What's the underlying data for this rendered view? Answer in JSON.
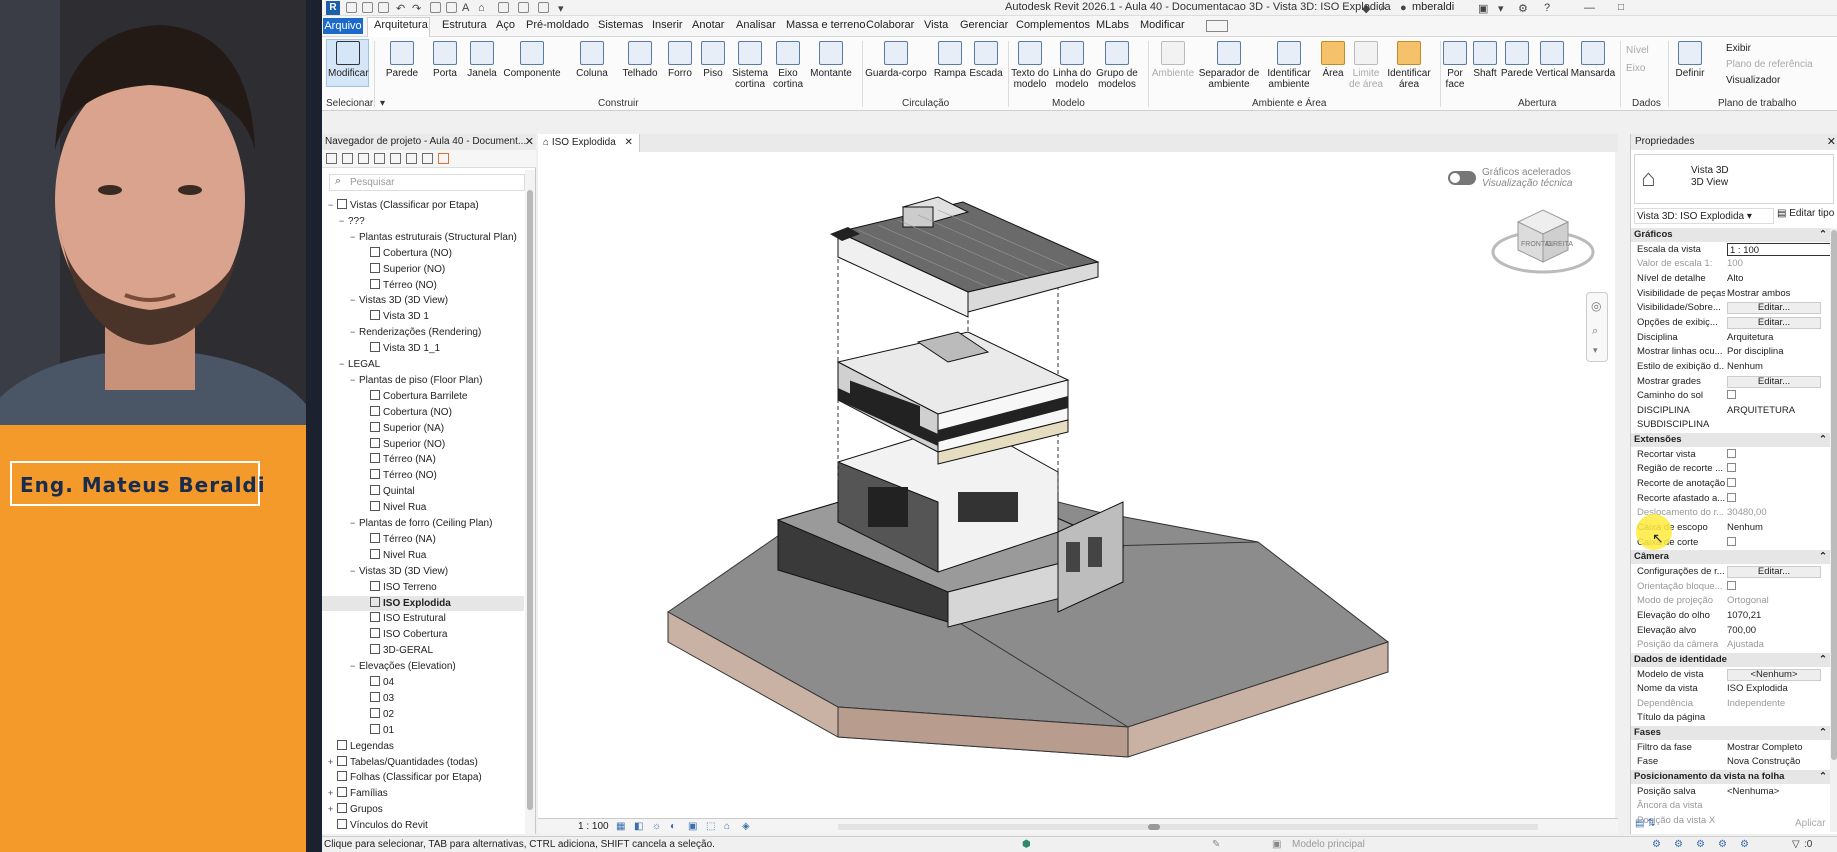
{
  "presenter": {
    "name": "Eng. Mateus Beraldi"
  },
  "app": {
    "title": "Autodesk Revit 2026.1 - Aula 40 - Documentacao 3D - Vista 3D: ISO Explodida",
    "user": "mberaldi",
    "logo_letter": "R"
  },
  "menu": {
    "tabs": [
      "Arquivo",
      "Arquitetura",
      "Estrutura",
      "Aço",
      "Pré-moldado",
      "Sistemas",
      "Inserir",
      "Anotar",
      "Analisar",
      "Massa e terreno",
      "Colaborar",
      "Vista",
      "Gerenciar",
      "Complementos",
      "MLabs",
      "Modificar"
    ]
  },
  "ribbon": {
    "modificar": "Modificar",
    "selecionar": "Selecionar",
    "construir": {
      "label": "Construir",
      "items": [
        "Parede",
        "Porta",
        "Janela",
        "Componente",
        "Coluna",
        "Telhado",
        "Forro",
        "Piso",
        "Sistema cortina",
        "Eixo cortina",
        "Montante"
      ]
    },
    "circulacao": {
      "label": "Circulação",
      "items": [
        "Guarda-corpo",
        "Rampa",
        "Escada"
      ]
    },
    "modelo": {
      "label": "Modelo",
      "items": [
        "Texto do modelo",
        "Linha do modelo",
        "Grupo de modelos"
      ]
    },
    "ambiente": {
      "label": "Ambiente e Área",
      "items": [
        "Ambiente",
        "Separador de ambiente",
        "Identificar ambiente",
        "Área",
        "Limite de área",
        "Identificar área"
      ]
    },
    "abertura": {
      "label": "Abertura",
      "items": [
        "Por face",
        "Shaft",
        "Parede",
        "Vertical",
        "Mansarda"
      ]
    },
    "dados": {
      "label": "Dados",
      "items": [
        "Nível",
        "Eixo"
      ]
    },
    "plano": {
      "label": "Plano de trabalho",
      "items": [
        "Definir",
        "Exibir",
        "Plano de referência",
        "Visualizador"
      ]
    }
  },
  "navigator": {
    "title": "Navegador de projeto - Aula 40 - Document...",
    "search_placeholder": "Pesquisar",
    "tree": [
      {
        "label": "Vistas (Classificar por Etapa)",
        "level": 0,
        "exp": "−",
        "icon": true
      },
      {
        "label": "???",
        "level": 1,
        "exp": "−"
      },
      {
        "label": "Plantas estruturais (Structural Plan)",
        "level": 2,
        "exp": "−"
      },
      {
        "label": "Cobertura (NO)",
        "level": 3,
        "icon": true
      },
      {
        "label": "Superior (NO)",
        "level": 3,
        "icon": true
      },
      {
        "label": "Térreo (NO)",
        "level": 3,
        "icon": true
      },
      {
        "label": "Vistas 3D (3D View)",
        "level": 2,
        "exp": "−"
      },
      {
        "label": "Vista 3D 1",
        "level": 3,
        "icon": true
      },
      {
        "label": "Renderizações (Rendering)",
        "level": 2,
        "exp": "−"
      },
      {
        "label": "Vista 3D 1_1",
        "level": 3,
        "icon": true
      },
      {
        "label": "LEGAL",
        "level": 1,
        "exp": "−"
      },
      {
        "label": "Plantas de piso (Floor Plan)",
        "level": 2,
        "exp": "−"
      },
      {
        "label": "Cobertura Barrilete",
        "level": 3,
        "icon": true
      },
      {
        "label": "Cobertura (NO)",
        "level": 3,
        "icon": true
      },
      {
        "label": "Superior (NA)",
        "level": 3,
        "icon": true
      },
      {
        "label": "Superior (NO)",
        "level": 3,
        "icon": true
      },
      {
        "label": "Térreo (NA)",
        "level": 3,
        "icon": true
      },
      {
        "label": "Térreo (NO)",
        "level": 3,
        "icon": true
      },
      {
        "label": "Quintal",
        "level": 3,
        "icon": true
      },
      {
        "label": "Nivel Rua",
        "level": 3,
        "icon": true
      },
      {
        "label": "Plantas de forro (Ceiling Plan)",
        "level": 2,
        "exp": "−"
      },
      {
        "label": "Térreo (NA)",
        "level": 3,
        "icon": true
      },
      {
        "label": "Nivel Rua",
        "level": 3,
        "icon": true
      },
      {
        "label": "Vistas 3D (3D View)",
        "level": 2,
        "exp": "−"
      },
      {
        "label": "ISO Terreno",
        "level": 3,
        "icon": true
      },
      {
        "label": "ISO Explodida",
        "level": 3,
        "icon": true,
        "selected": true
      },
      {
        "label": "ISO Estrutural",
        "level": 3,
        "icon": true
      },
      {
        "label": "ISO Cobertura",
        "level": 3,
        "icon": true
      },
      {
        "label": "3D-GERAL",
        "level": 3,
        "icon": true
      },
      {
        "label": "Elevações (Elevation)",
        "level": 2,
        "exp": "−"
      },
      {
        "label": "04",
        "level": 3,
        "icon": true
      },
      {
        "label": "03",
        "level": 3,
        "icon": true
      },
      {
        "label": "02",
        "level": 3,
        "icon": true
      },
      {
        "label": "01",
        "level": 3,
        "icon": true
      },
      {
        "label": "Legendas",
        "level": 0,
        "icon": true
      },
      {
        "label": "Tabelas/Quantidades (todas)",
        "level": 0,
        "exp": "+",
        "icon": true
      },
      {
        "label": "Folhas (Classificar por Etapa)",
        "level": 0,
        "icon": true
      },
      {
        "label": "Famílias",
        "level": 0,
        "exp": "+",
        "icon": true
      },
      {
        "label": "Grupos",
        "level": 0,
        "exp": "+",
        "icon": true
      },
      {
        "label": "Vínculos do Revit",
        "level": 0,
        "icon": true
      }
    ]
  },
  "view": {
    "tab_label": "ISO Explodida",
    "accel_line1": "Gráficos acelerados",
    "accel_line2": "Visualização técnica",
    "scale": "1 : 100",
    "viewcube_front": "FRONTAL",
    "viewcube_right": "DIREITA"
  },
  "properties": {
    "title": "Propriedades",
    "type_name1": "Vista 3D",
    "type_name2": "3D View",
    "selector": "Vista 3D: ISO Explodida",
    "edit_type": "Editar tipo",
    "rows": [
      {
        "kind": "sec",
        "label": "Gráficos"
      },
      {
        "label": "Escala da vista",
        "value": "1 : 100",
        "input": true
      },
      {
        "label": "Valor de escala    1:",
        "value": "100",
        "dim": true
      },
      {
        "label": "Nível de detalhe",
        "value": "Alto"
      },
      {
        "label": "Visibilidade de peças",
        "value": "Mostrar ambos"
      },
      {
        "label": "Visibilidade/Sobre...",
        "value": "Editar...",
        "button": true
      },
      {
        "label": "Opções de exibiç...",
        "value": "Editar...",
        "button": true
      },
      {
        "label": "Disciplina",
        "value": "Arquitetura"
      },
      {
        "label": "Mostrar linhas ocu...",
        "value": "Por disciplina"
      },
      {
        "label": "Estilo de exibição d...",
        "value": "Nenhum"
      },
      {
        "label": "Mostrar grades",
        "value": "Editar...",
        "button": true
      },
      {
        "label": "Caminho do sol",
        "check": true
      },
      {
        "label": "DISCIPLINA",
        "value": "ARQUITETURA"
      },
      {
        "label": "SUBDISCIPLINA",
        "value": ""
      },
      {
        "kind": "sec",
        "label": "Extensões"
      },
      {
        "label": "Recortar vista",
        "check": true
      },
      {
        "label": "Região de recorte ...",
        "check": true
      },
      {
        "label": "Recorte de anotação",
        "check": true
      },
      {
        "label": "Recorte afastado a...",
        "check": true
      },
      {
        "label": "Deslocamento do r...",
        "value": "30480,00",
        "dim": true
      },
      {
        "label": "Caixa de escopo",
        "value": "Nenhum"
      },
      {
        "label": "Caixa de corte",
        "check": true
      },
      {
        "kind": "sec",
        "label": "Câmera"
      },
      {
        "label": "Configurações de r...",
        "value": "Editar...",
        "button": true
      },
      {
        "label": "Orientação bloque...",
        "check": true,
        "dim": true
      },
      {
        "label": "Modo de projeção",
        "value": "Ortogonal",
        "dim": true
      },
      {
        "label": "Elevação do olho",
        "value": "1070,21"
      },
      {
        "label": "Elevação alvo",
        "value": "700,00"
      },
      {
        "label": "Posição da câmera",
        "value": "Ajustada",
        "dim": true
      },
      {
        "kind": "sec",
        "label": "Dados de identidade"
      },
      {
        "label": "Modelo de vista",
        "value": "<Nenhum>",
        "button": true
      },
      {
        "label": "Nome da vista",
        "value": "ISO Explodida"
      },
      {
        "label": "Dependência",
        "value": "Independente",
        "dim": true
      },
      {
        "label": "Título da página",
        "value": ""
      },
      {
        "kind": "sec",
        "label": "Fases"
      },
      {
        "label": "Filtro da fase",
        "value": "Mostrar Completo"
      },
      {
        "label": "Fase",
        "value": "Nova Construção"
      },
      {
        "kind": "sec",
        "label": "Posicionamento da vista na folha"
      },
      {
        "label": "Posição salva",
        "value": "<Nenhuma>"
      },
      {
        "label": "Âncora da vista",
        "value": "",
        "dim": true
      },
      {
        "label": "Posição da vista X",
        "value": "",
        "dim": true
      }
    ],
    "apply": "Aplicar"
  },
  "status": {
    "text": "Clique para selecionar, TAB para alternativas, CTRL adiciona, SHIFT cancela a seleção.",
    "model": "Modelo principal",
    "count": ":0"
  }
}
